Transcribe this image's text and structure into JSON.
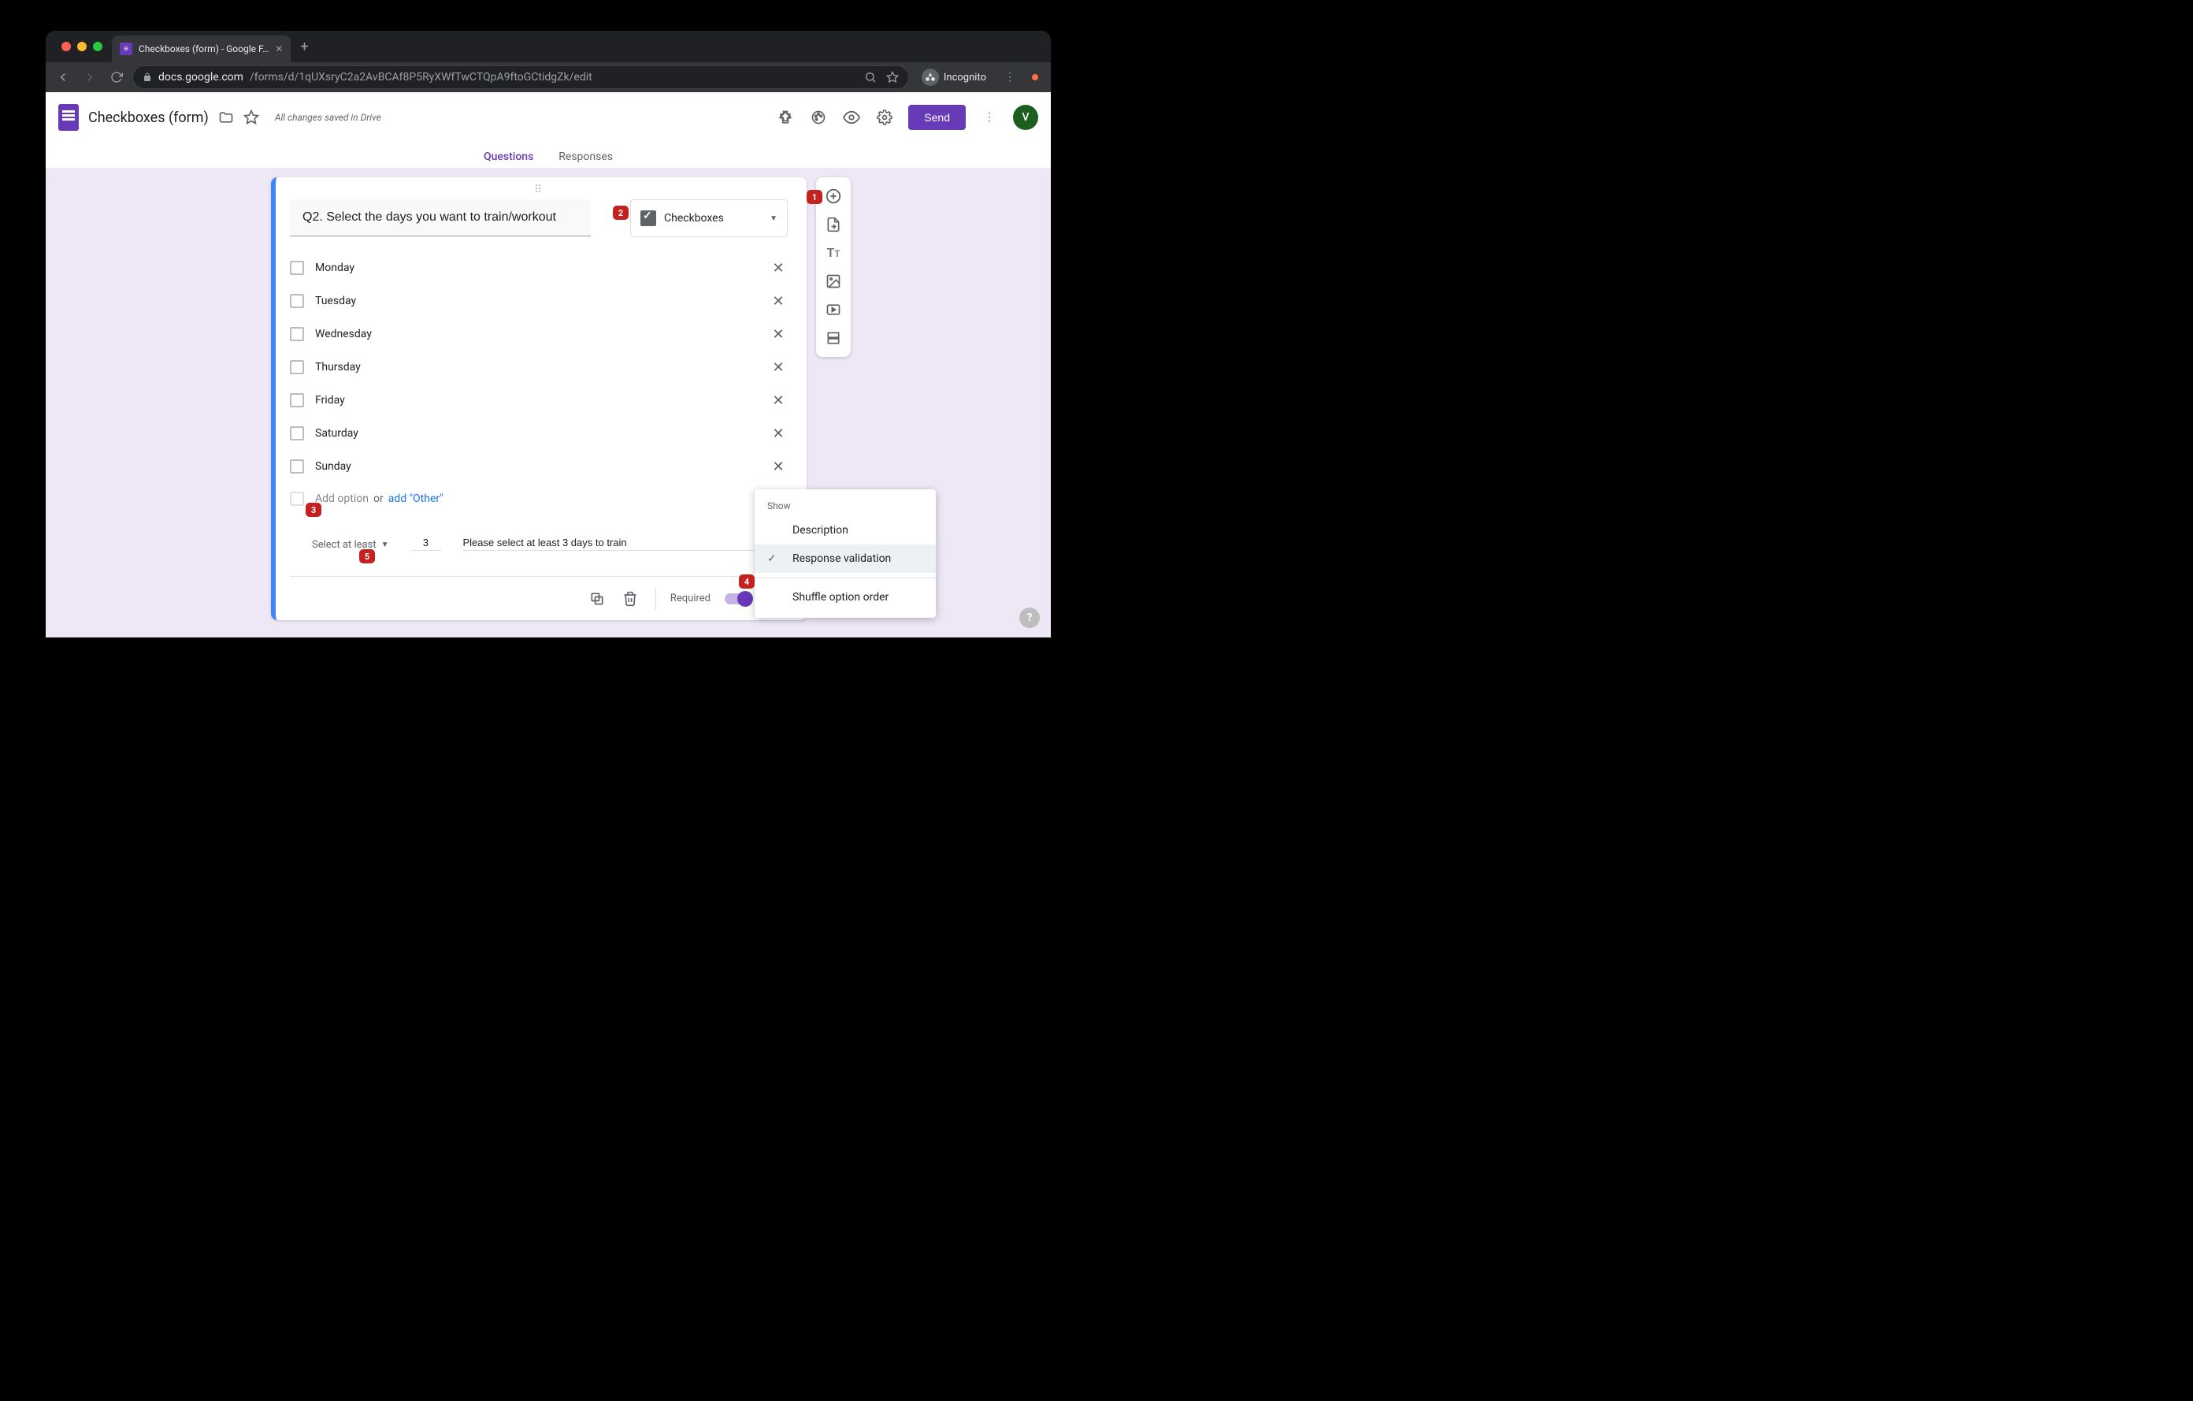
{
  "browser": {
    "tab_title": "Checkboxes (form) - Google F…",
    "url_secure_host": "docs.google.com",
    "url_path": "/forms/d/1qUXsryC2a2AvBCAf8P5RyXWfTwCTQpA9ftoGCtidgZk/edit",
    "incognito_label": "Incognito"
  },
  "header": {
    "title": "Checkboxes (form)",
    "save_status": "All changes saved in Drive",
    "send_label": "Send",
    "avatar_letter": "V"
  },
  "tabs": {
    "questions": "Questions",
    "responses": "Responses"
  },
  "question": {
    "drag": "⠿",
    "title": "Q2. Select the days you want to train/workout",
    "type_label": "Checkboxes",
    "options": [
      "Monday",
      "Tuesday",
      "Wednesday",
      "Thursday",
      "Friday",
      "Saturday",
      "Sunday"
    ],
    "add_option_placeholder": "Add option",
    "or_label": "or",
    "add_other_label": "add \"Other\"",
    "validation": {
      "mode": "Select at least",
      "number": "3",
      "message": "Please select at least 3 days to train"
    },
    "required_label": "Required"
  },
  "side_tools": [
    "add",
    "import",
    "title",
    "image",
    "video",
    "section"
  ],
  "menu": {
    "show": "Show",
    "description": "Description",
    "validation": "Response validation",
    "shuffle": "Shuffle option order"
  },
  "badges": {
    "b1": "1",
    "b2": "2",
    "b3": "3",
    "b4": "4",
    "b5": "5"
  }
}
